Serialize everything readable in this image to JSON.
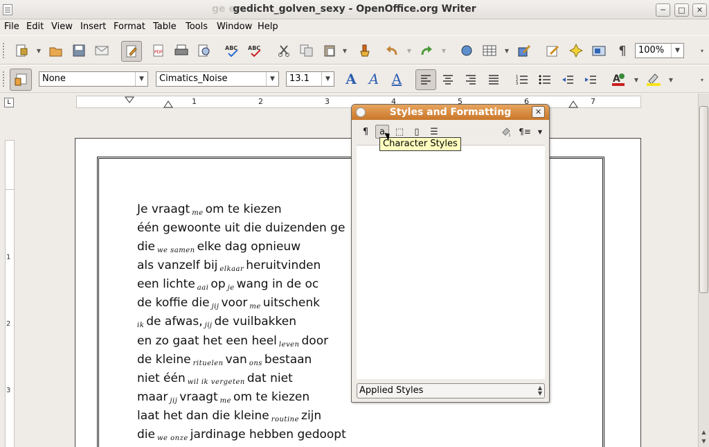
{
  "window": {
    "title": "gedicht_golven_sexy - OpenOffice.org Writer",
    "ghost_title": "ge                                                     er",
    "controls": {
      "minimize": "─",
      "maximize": "□",
      "close": "✕"
    }
  },
  "menu": [
    "File",
    "Edit",
    "View",
    "Insert",
    "Format",
    "Table",
    "Tools",
    "Window",
    "Help"
  ],
  "standard_toolbar": {
    "zoom": "100%"
  },
  "formatting_toolbar": {
    "paragraph_style": "None",
    "font_name": "Cimatics_Noise",
    "font_size": "13.1",
    "font_buttons": {
      "bold": "A",
      "italic": "A",
      "underline": "A"
    }
  },
  "ruler": {
    "h_numbers": [
      "1",
      "2",
      "3",
      "4",
      "5",
      "6",
      "7"
    ],
    "v_numbers": [
      "1",
      "2",
      "3"
    ],
    "corner": "L"
  },
  "poem": [
    {
      "before": "Je vraagt",
      "hw": "me",
      "after": "om te kiezen"
    },
    {
      "before": "één gewoonte uit die duizenden ge",
      "hw": "",
      "after": ""
    },
    {
      "before": "die",
      "hw": "we samen",
      "after": "elke dag opnieuw"
    },
    {
      "before": "als vanzelf bij",
      "hw": "elkaar",
      "after": "heruitvinden"
    },
    {
      "before": "een lichte",
      "hw": "aai",
      "after": "op",
      "hw2": "je",
      "after2": "wang in de oc"
    },
    {
      "before": "de koffie die",
      "hw": "jij",
      "after": "voor",
      "hw2": "me",
      "after2": "uitschenk"
    },
    {
      "before": "",
      "hw": "ik",
      "after": "de afwas,",
      "hw2": "jij",
      "after2": "de vuilbakken"
    },
    {
      "before": "en zo gaat het een heel",
      "hw": "leven",
      "after": "door"
    },
    {
      "before": "de kleine",
      "hw": "rituelen",
      "after": "van",
      "hw2": "ons",
      "after2": "bestaan"
    },
    {
      "before": "niet één",
      "hw": "wil ik vergeten",
      "after": "dat niet"
    },
    {
      "before": "maar",
      "hw": "jij",
      "after": "vraagt",
      "hw2": "me",
      "after2": "om te kiezen"
    },
    {
      "before": "laat het dan die kleine",
      "hw": "routine",
      "after": "zijn"
    },
    {
      "before": "die",
      "hw": "we onze",
      "after": "jardinage hebben gedoopt"
    }
  ],
  "styles_panel": {
    "title": "Styles and Formatting",
    "close": "✕",
    "tooltip": "Character Styles",
    "filter": "Applied Styles",
    "buttons": [
      "¶",
      "a",
      "⬚",
      "▯",
      "☰"
    ],
    "fill_icon": "fill-format-icon",
    "new_style_label": "¶≡"
  },
  "colors": {
    "panel_title": "#d8883c",
    "tooltip_bg": "#ffffbf",
    "toolbar_bg": "#efebe7"
  }
}
